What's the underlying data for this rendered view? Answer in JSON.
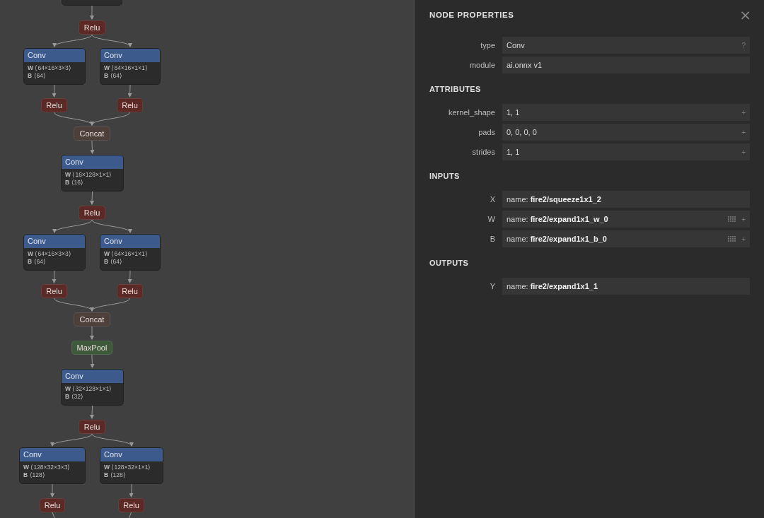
{
  "graph": {
    "nodes": [
      {
        "kind": "stub"
      },
      {
        "kind": "op",
        "color": "#5b2926",
        "label": "Relu"
      },
      {
        "kind": "conv",
        "label": "Conv",
        "attributes": [
          {
            "name": "W",
            "value": "⟨64×16×3×3⟩"
          },
          {
            "name": "B",
            "value": "⟨64⟩"
          }
        ]
      },
      {
        "kind": "conv",
        "label": "Conv",
        "attributes": [
          {
            "name": "W",
            "value": "⟨64×16×1×1⟩"
          },
          {
            "name": "B",
            "value": "⟨64⟩"
          }
        ]
      },
      {
        "kind": "op",
        "color": "#5b2926",
        "label": "Relu"
      },
      {
        "kind": "op",
        "color": "#5b2926",
        "label": "Relu"
      },
      {
        "kind": "op",
        "color": "#4d3f3a",
        "label": "Concat"
      },
      {
        "kind": "conv",
        "label": "Conv",
        "attributes": [
          {
            "name": "W",
            "value": "⟨16×128×1×1⟩"
          },
          {
            "name": "B",
            "value": "⟨16⟩"
          }
        ]
      },
      {
        "kind": "op",
        "color": "#5b2926",
        "label": "Relu"
      },
      {
        "kind": "conv",
        "label": "Conv",
        "attributes": [
          {
            "name": "W",
            "value": "⟨64×16×3×3⟩"
          },
          {
            "name": "B",
            "value": "⟨64⟩"
          }
        ]
      },
      {
        "kind": "conv",
        "label": "Conv",
        "attributes": [
          {
            "name": "W",
            "value": "⟨64×16×1×1⟩"
          },
          {
            "name": "B",
            "value": "⟨64⟩"
          }
        ]
      },
      {
        "kind": "op",
        "color": "#5b2926",
        "label": "Relu"
      },
      {
        "kind": "op",
        "color": "#5b2926",
        "label": "Relu"
      },
      {
        "kind": "op",
        "color": "#4d3f3a",
        "label": "Concat"
      },
      {
        "kind": "op",
        "color": "#3e5a3b",
        "label": "MaxPool"
      },
      {
        "kind": "conv",
        "label": "Conv",
        "attributes": [
          {
            "name": "W",
            "value": "⟨32×128×1×1⟩"
          },
          {
            "name": "B",
            "value": "⟨32⟩"
          }
        ]
      },
      {
        "kind": "op",
        "color": "#5b2926",
        "label": "Relu"
      },
      {
        "kind": "conv",
        "label": "Conv",
        "attributes": [
          {
            "name": "W",
            "value": "⟨128×32×3×3⟩"
          },
          {
            "name": "B",
            "value": "⟨128⟩"
          }
        ]
      },
      {
        "kind": "conv",
        "label": "Conv",
        "attributes": [
          {
            "name": "W",
            "value": "⟨128×32×1×1⟩"
          },
          {
            "name": "B",
            "value": "⟨128⟩"
          }
        ]
      },
      {
        "kind": "op",
        "color": "#5b2926",
        "label": "Relu"
      },
      {
        "kind": "op",
        "color": "#5b2926",
        "label": "Relu"
      }
    ]
  },
  "panel": {
    "title": "NODE PROPERTIES",
    "close": "×",
    "sections": [
      {
        "rows": [
          {
            "label": "type",
            "value": "Conv",
            "buttons": [
              {
                "kind": "text",
                "label": "?"
              }
            ]
          },
          {
            "label": "module",
            "value": "ai.onnx v1"
          }
        ]
      },
      {
        "title": "ATTRIBUTES",
        "rows": [
          {
            "label": "kernel_shape",
            "value": "1, 1",
            "buttons": [
              {
                "kind": "text",
                "label": "+"
              }
            ]
          },
          {
            "label": "pads",
            "value": "0, 0, 0, 0",
            "buttons": [
              {
                "kind": "text",
                "label": "+"
              }
            ]
          },
          {
            "label": "strides",
            "value": "1, 1",
            "buttons": [
              {
                "kind": "text",
                "label": "+"
              }
            ]
          }
        ]
      },
      {
        "title": "INPUTS",
        "rows": [
          {
            "label": "X",
            "value": "name: **fire2/squeeze1x1_2**"
          },
          {
            "label": "W",
            "value": "name: **fire2/expand1x1_w_0**",
            "buttons": [
              {
                "kind": "grid"
              },
              {
                "kind": "text",
                "label": "+"
              }
            ]
          },
          {
            "label": "B",
            "value": "name: **fire2/expand1x1_b_0**",
            "buttons": [
              {
                "kind": "grid"
              },
              {
                "kind": "text",
                "label": "+"
              }
            ]
          }
        ]
      },
      {
        "title": "OUTPUTS",
        "rows": [
          {
            "label": "Y",
            "value": "name: **fire2/expand1x1_1**"
          }
        ]
      }
    ]
  }
}
